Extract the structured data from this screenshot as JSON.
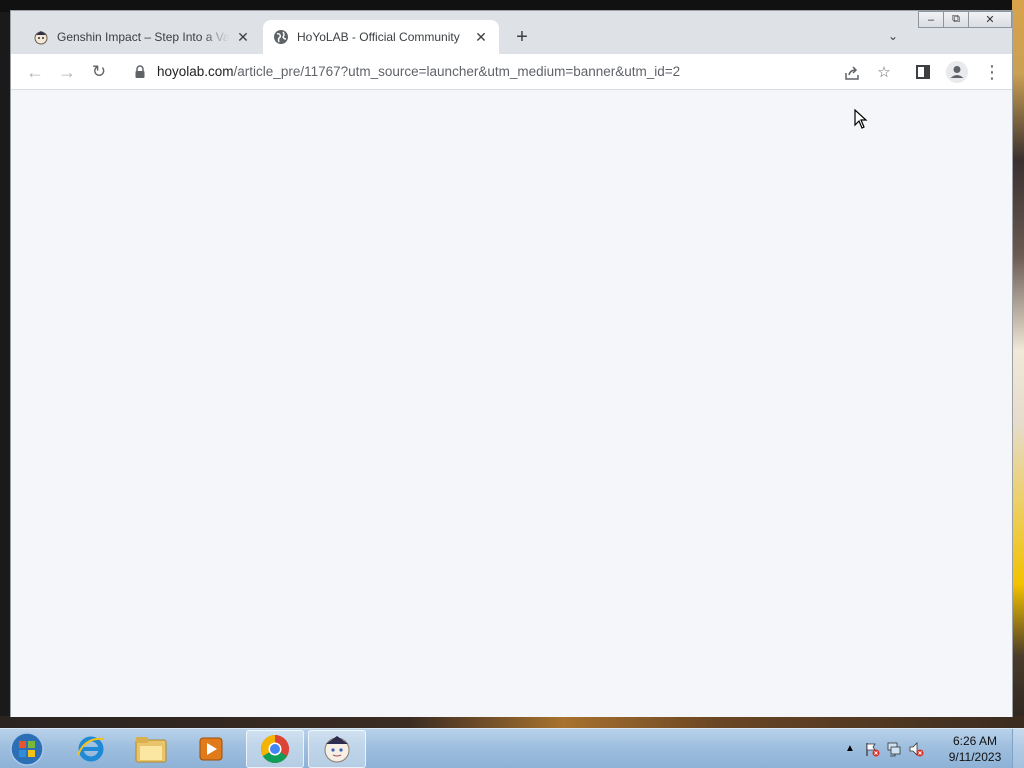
{
  "browser": {
    "tabs": [
      {
        "title": "Genshin Impact – Step Into a Vast",
        "favicon": "genshin-paimon-icon",
        "active": false
      },
      {
        "title": "HoYoLAB - Official Community",
        "favicon": "globe-icon",
        "active": true
      }
    ],
    "address": {
      "domain": "hoyolab.com",
      "path": "/article_pre/11767?utm_source=launcher&utm_medium=banner&utm_id=2"
    },
    "window_controls": [
      "minimize-icon",
      "restore-icon",
      "close-icon"
    ]
  },
  "taskbar": {
    "pinned": [
      "internet-explorer-icon",
      "windows-explorer-icon",
      "media-player-icon",
      "chrome-icon",
      "genshin-launcher-icon"
    ],
    "clock": {
      "time": "6:26 AM",
      "date": "9/11/2023"
    }
  },
  "colors": {
    "page_background": "#f5f6fa",
    "tabstrip": "#dee1e6",
    "taskbar": "#9fbfdf"
  }
}
